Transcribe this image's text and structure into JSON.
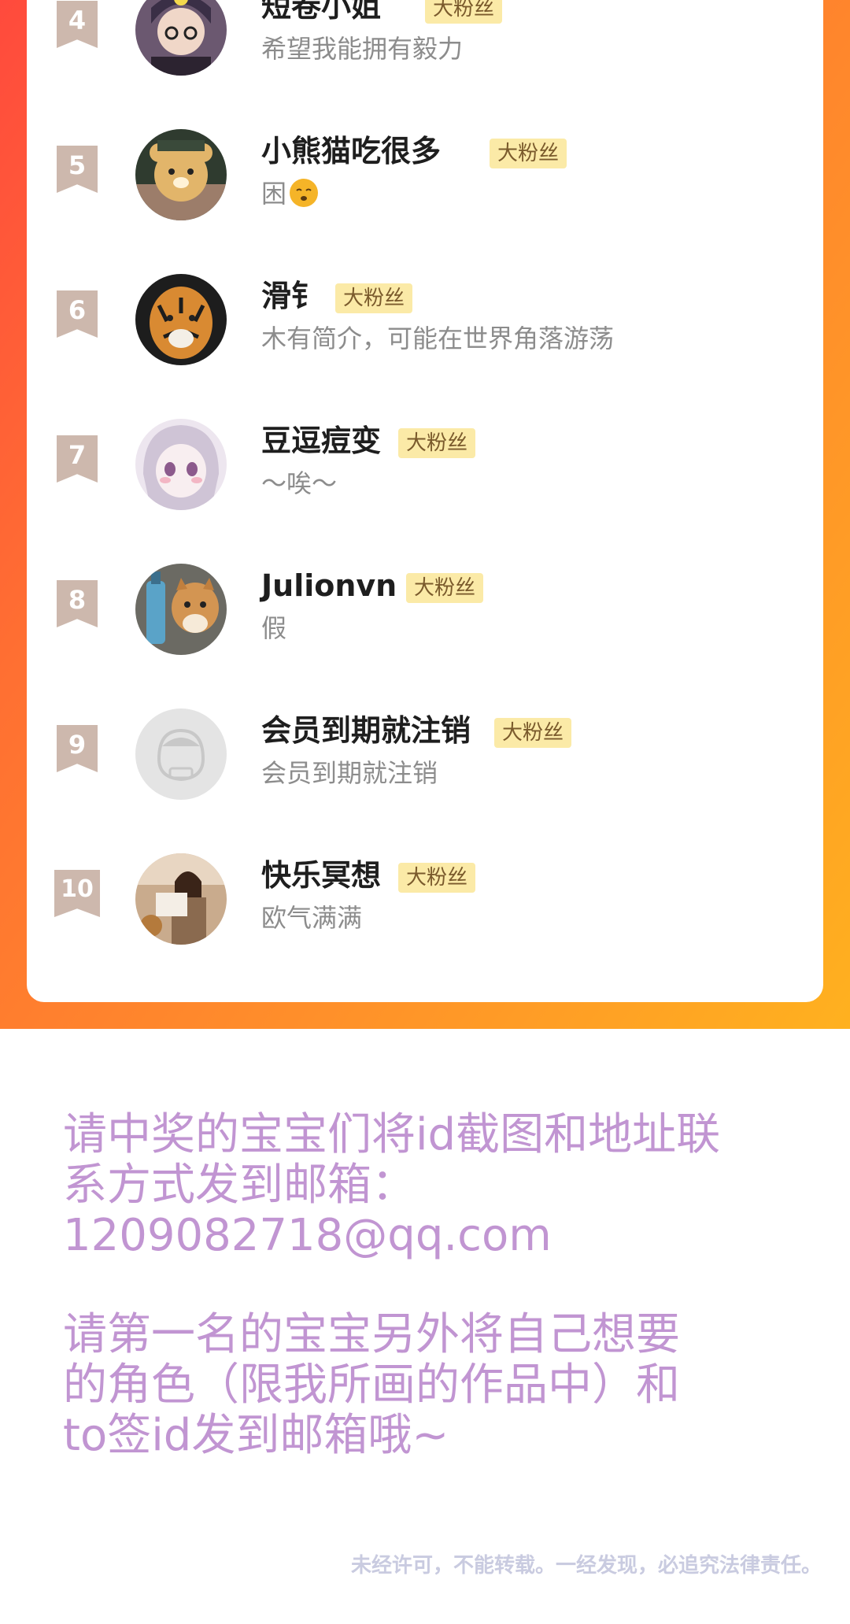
{
  "ranking": {
    "entries": [
      {
        "rank": "4",
        "name": "短卷小姐",
        "badge": "大粉丝",
        "bio": "希望我能拥有毅力"
      },
      {
        "rank": "5",
        "name": "小熊猫吃很多",
        "badge": "大粉丝",
        "bio": "困"
      },
      {
        "rank": "6",
        "name": "滑钅",
        "badge": "大粉丝",
        "bio": "木有简介，可能在世界角落游荡"
      },
      {
        "rank": "7",
        "name": "豆逗痘变",
        "badge": "大粉丝",
        "bio": "～唉～"
      },
      {
        "rank": "8",
        "name": "Julionvn",
        "badge": "大粉丝",
        "bio": "假"
      },
      {
        "rank": "9",
        "name": "会员到期就注销",
        "badge": "大粉丝",
        "bio": "会员到期就注销"
      },
      {
        "rank": "10",
        "name": "快乐冥想",
        "badge": "大粉丝",
        "bio": "欧气满满"
      }
    ]
  },
  "notice": {
    "line1": "请中奖的宝宝们将id截图和地址联",
    "line2": "系方式发到邮箱：",
    "line3": "1209082718@qq.com",
    "line4": "请第一名的宝宝另外将自己想要",
    "line5": "的角色（限我所画的作品中）和",
    "line6": "to签id发到邮箱哦~"
  },
  "footer": {
    "copyright": "未经许可，不能转载。一经发现，必追究法律责任。"
  },
  "colors": {
    "gradient_start": "#ff4a3d",
    "gradient_end": "#ffb11f",
    "badge_bg": "#fbeaa7",
    "rank_bg": "#cdb8ad",
    "notice_text": "#c195d2"
  }
}
